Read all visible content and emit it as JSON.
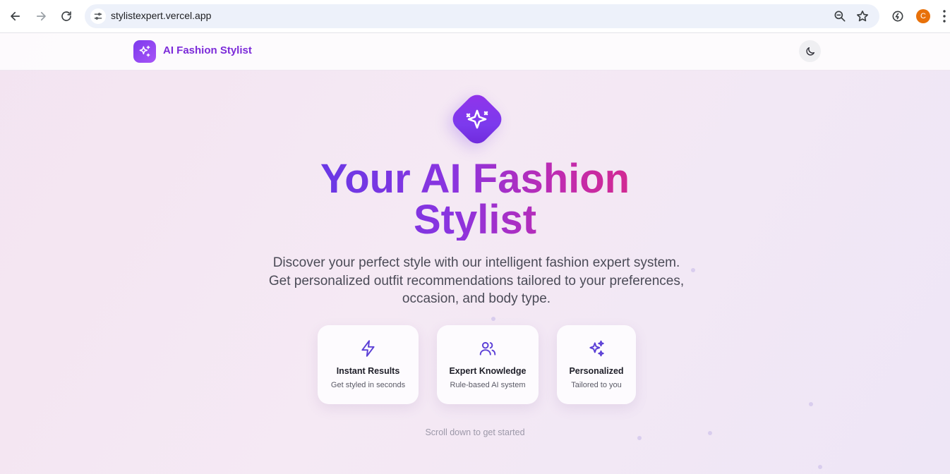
{
  "browser": {
    "url": "stylistexpert.vercel.app",
    "profile_initial": "C",
    "profile_color": "#e8710a"
  },
  "header": {
    "app_name": "AI Fashion Stylist",
    "logo_icon": "sparkles-icon",
    "theme_icon": "moon-icon"
  },
  "hero": {
    "icon": "sparkle-star-icon",
    "title_line1": "Your AI Fashion",
    "title_line2": "Stylist",
    "subtitle_line1": "Discover your perfect style with our intelligent fashion expert system.",
    "subtitle_line2": "Get personalized outfit recommendations tailored to your preferences,",
    "subtitle_line3": "occasion, and body type."
  },
  "features": [
    {
      "icon": "lightning-icon",
      "title": "Instant Results",
      "description": "Get styled in seconds"
    },
    {
      "icon": "users-icon",
      "title": "Expert Knowledge",
      "description": "Rule-based AI system"
    },
    {
      "icon": "sparkles-icon",
      "title": "Personalized",
      "description": "Tailored to you"
    }
  ],
  "scroll_hint": "Scroll down to get started",
  "colors": {
    "accent": "#7c3aed",
    "gradient_start": "#5b3ae8",
    "gradient_end": "#e0297a",
    "icon_color": "#5b3fd6"
  }
}
